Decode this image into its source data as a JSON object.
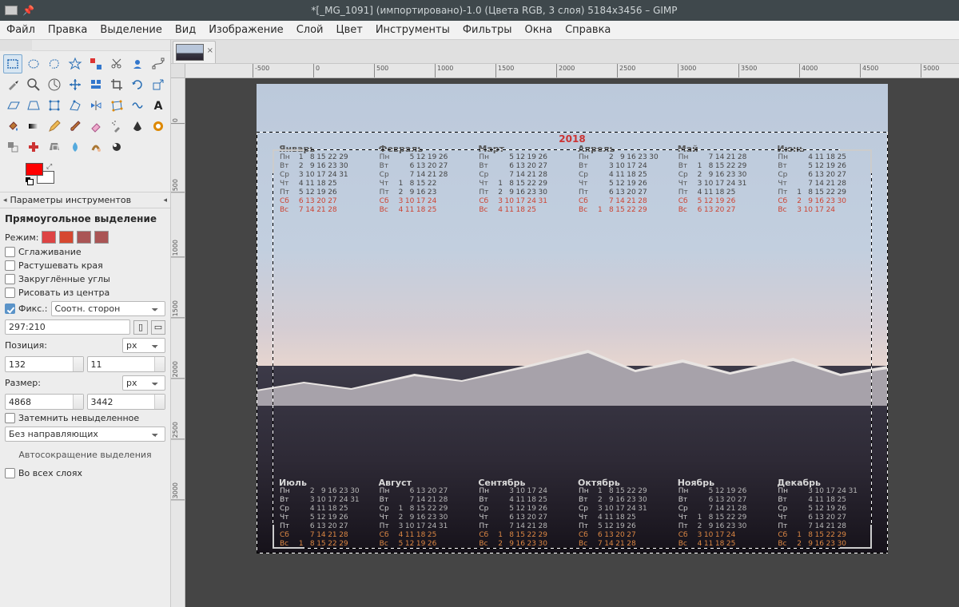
{
  "titlebar": {
    "title": "*[_MG_1091] (импортировано)-1.0 (Цвета RGB, 3 слоя) 5184x3456 – GIMP"
  },
  "menu": {
    "items": [
      "Файл",
      "Правка",
      "Выделение",
      "Вид",
      "Изображение",
      "Слой",
      "Цвет",
      "Инструменты",
      "Фильтры",
      "Окна",
      "Справка"
    ]
  },
  "tools": [
    "rect-select",
    "ellipse-select",
    "free-select",
    "fuzzy-select",
    "by-color-select",
    "scissors",
    "foreground-select",
    "paths",
    "color-picker",
    "zoom",
    "measure",
    "move",
    "align",
    "crop",
    "rotate",
    "scale",
    "shear",
    "perspective",
    "unified-transform",
    "handle-transform",
    "flip",
    "cage",
    "warp",
    "text",
    "bucket-fill",
    "blend",
    "pencil",
    "paintbrush",
    "eraser",
    "airbrush",
    "ink",
    "mypaint",
    "clone",
    "heal",
    "perspective-clone",
    "blur",
    "smudge",
    "dodge"
  ],
  "toolopts": {
    "panel_title": "Параметры инструментов",
    "tool_name": "Прямоугольное выделение",
    "mode_label": "Режим:",
    "antialias": "Сглаживание",
    "feather": "Растушевать края",
    "rounded": "Закруглённые углы",
    "from_center": "Рисовать из центра",
    "fixed_label": "Фикс.:",
    "fixed_value": "Соотн. сторон",
    "aspect": "297:210",
    "position_label": "Позиция:",
    "pos_x": "132",
    "pos_y": "11",
    "size_label": "Размер:",
    "size_w": "4868",
    "size_h": "3442",
    "unit": "px",
    "highlight": "Затемнить невыделенное",
    "guides": "Без направляющих",
    "autoshrink": "Автосокращение выделения",
    "all_layers": "Во всех слоях"
  },
  "ruler_h": [
    "0",
    "500",
    "1000",
    "1500",
    "2000",
    "2500",
    "3000",
    "3500",
    "4000",
    "4500",
    "5000"
  ],
  "ruler_h_neg": "-500",
  "ruler_v": [
    "0",
    "500",
    "1000",
    "1500",
    "2000",
    "2500",
    "3000"
  ],
  "calendar": {
    "year": "2018",
    "weekdays": [
      "Пн",
      "Вт",
      "Ср",
      "Чт",
      "Пт",
      "Сб",
      "Вс"
    ],
    "top_months": [
      "Январь",
      "Февраль",
      "Март",
      "Апрель",
      "Май",
      "Июнь"
    ],
    "bot_months": [
      "Июль",
      "Август",
      "Сентябрь",
      "Октябрь",
      "Ноябрь",
      "Декабрь"
    ],
    "grids": {
      "Январь": [
        [
          1,
          8,
          15,
          22,
          29
        ],
        [
          2,
          9,
          16,
          23,
          30
        ],
        [
          3,
          10,
          17,
          24,
          31
        ],
        [
          4,
          11,
          18,
          25,
          null
        ],
        [
          5,
          12,
          19,
          26,
          null
        ],
        [
          6,
          13,
          20,
          27,
          null
        ],
        [
          7,
          14,
          21,
          28,
          null
        ]
      ],
      "Февраль": [
        [
          null,
          5,
          12,
          19,
          26
        ],
        [
          null,
          6,
          13,
          20,
          27
        ],
        [
          null,
          7,
          14,
          21,
          28
        ],
        [
          1,
          8,
          15,
          22,
          null
        ],
        [
          2,
          9,
          16,
          23,
          null
        ],
        [
          3,
          10,
          17,
          24,
          null
        ],
        [
          4,
          11,
          18,
          25,
          null
        ]
      ],
      "Март": [
        [
          null,
          5,
          12,
          19,
          26
        ],
        [
          null,
          6,
          13,
          20,
          27
        ],
        [
          null,
          7,
          14,
          21,
          28
        ],
        [
          1,
          8,
          15,
          22,
          29
        ],
        [
          2,
          9,
          16,
          23,
          30
        ],
        [
          3,
          10,
          17,
          24,
          31
        ],
        [
          4,
          11,
          18,
          25,
          null
        ]
      ],
      "Апрель": [
        [
          null,
          2,
          9,
          16,
          23,
          30
        ],
        [
          null,
          3,
          10,
          17,
          24,
          null
        ],
        [
          null,
          4,
          11,
          18,
          25,
          null
        ],
        [
          null,
          5,
          12,
          19,
          26,
          null
        ],
        [
          null,
          6,
          13,
          20,
          27,
          null
        ],
        [
          null,
          7,
          14,
          21,
          28,
          null
        ],
        [
          1,
          8,
          15,
          22,
          29,
          null
        ]
      ],
      "Май": [
        [
          null,
          7,
          14,
          21,
          28
        ],
        [
          1,
          8,
          15,
          22,
          29
        ],
        [
          2,
          9,
          16,
          23,
          30
        ],
        [
          3,
          10,
          17,
          24,
          31
        ],
        [
          4,
          11,
          18,
          25,
          null
        ],
        [
          5,
          12,
          19,
          26,
          null
        ],
        [
          6,
          13,
          20,
          27,
          null
        ]
      ],
      "Июнь": [
        [
          null,
          4,
          11,
          18,
          25
        ],
        [
          null,
          5,
          12,
          19,
          26
        ],
        [
          null,
          6,
          13,
          20,
          27
        ],
        [
          null,
          7,
          14,
          21,
          28
        ],
        [
          1,
          8,
          15,
          22,
          29
        ],
        [
          2,
          9,
          16,
          23,
          30
        ],
        [
          3,
          10,
          17,
          24,
          null
        ]
      ],
      "Июль": [
        [
          null,
          2,
          9,
          16,
          23,
          30
        ],
        [
          null,
          3,
          10,
          17,
          24,
          31
        ],
        [
          null,
          4,
          11,
          18,
          25,
          null
        ],
        [
          null,
          5,
          12,
          19,
          26,
          null
        ],
        [
          null,
          6,
          13,
          20,
          27,
          null
        ],
        [
          null,
          7,
          14,
          21,
          28,
          null
        ],
        [
          1,
          8,
          15,
          22,
          29,
          null
        ]
      ],
      "Август": [
        [
          null,
          6,
          13,
          20,
          27
        ],
        [
          null,
          7,
          14,
          21,
          28
        ],
        [
          1,
          8,
          15,
          22,
          29
        ],
        [
          2,
          9,
          16,
          23,
          30
        ],
        [
          3,
          10,
          17,
          24,
          31
        ],
        [
          4,
          11,
          18,
          25,
          null
        ],
        [
          5,
          12,
          19,
          26,
          null
        ]
      ],
      "Сентябрь": [
        [
          null,
          3,
          10,
          17,
          24
        ],
        [
          null,
          4,
          11,
          18,
          25
        ],
        [
          null,
          5,
          12,
          19,
          26
        ],
        [
          null,
          6,
          13,
          20,
          27
        ],
        [
          null,
          7,
          14,
          21,
          28
        ],
        [
          1,
          8,
          15,
          22,
          29
        ],
        [
          2,
          9,
          16,
          23,
          30
        ]
      ],
      "Октябрь": [
        [
          1,
          8,
          15,
          22,
          29
        ],
        [
          2,
          9,
          16,
          23,
          30
        ],
        [
          3,
          10,
          17,
          24,
          31
        ],
        [
          4,
          11,
          18,
          25,
          null
        ],
        [
          5,
          12,
          19,
          26,
          null
        ],
        [
          6,
          13,
          20,
          27,
          null
        ],
        [
          7,
          14,
          21,
          28,
          null
        ]
      ],
      "Ноябрь": [
        [
          null,
          5,
          12,
          19,
          26
        ],
        [
          null,
          6,
          13,
          20,
          27
        ],
        [
          null,
          7,
          14,
          21,
          28
        ],
        [
          1,
          8,
          15,
          22,
          29
        ],
        [
          2,
          9,
          16,
          23,
          30
        ],
        [
          3,
          10,
          17,
          24,
          null
        ],
        [
          4,
          11,
          18,
          25,
          null
        ]
      ],
      "Декабрь": [
        [
          null,
          3,
          10,
          17,
          24,
          31
        ],
        [
          null,
          4,
          11,
          18,
          25,
          null
        ],
        [
          null,
          5,
          12,
          19,
          26,
          null
        ],
        [
          null,
          6,
          13,
          20,
          27,
          null
        ],
        [
          null,
          7,
          14,
          21,
          28,
          null
        ],
        [
          1,
          8,
          15,
          22,
          29,
          null
        ],
        [
          2,
          9,
          16,
          23,
          30,
          null
        ]
      ]
    }
  }
}
